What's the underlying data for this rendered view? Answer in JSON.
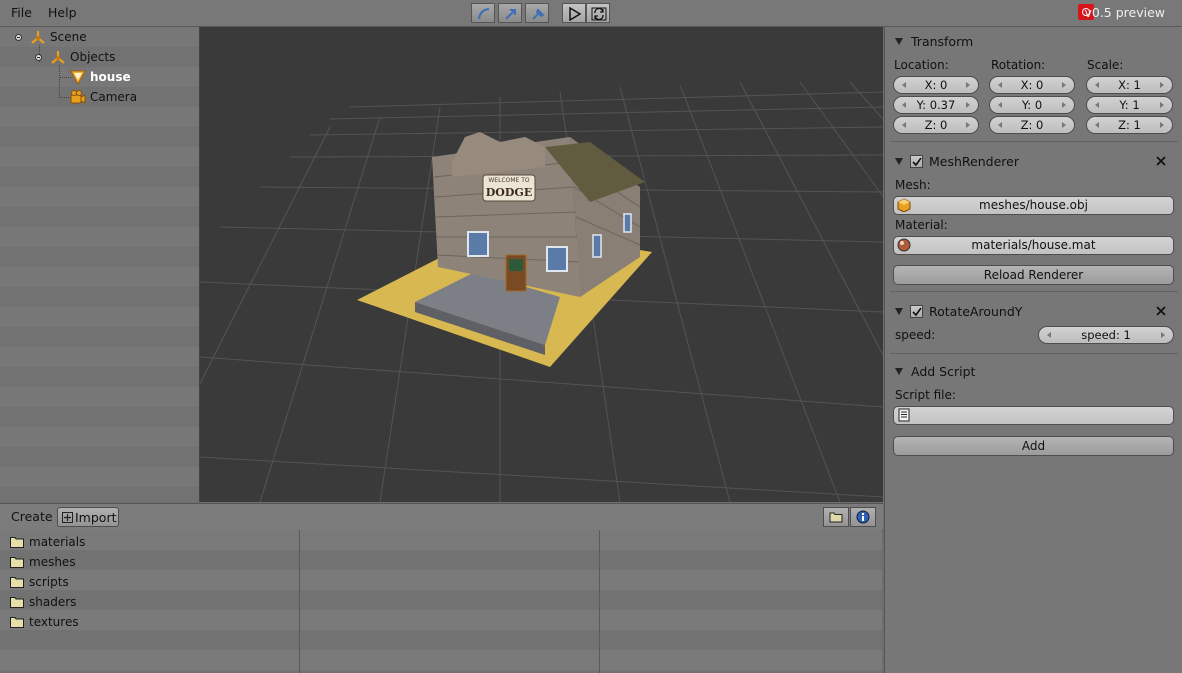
{
  "menu": {
    "file": "File",
    "help": "Help"
  },
  "toolbar": {
    "tools": [
      "curve-tool-icon",
      "move-tool-icon",
      "select-tool-icon"
    ],
    "play_icon": "play-icon",
    "refresh_icon": "refresh-icon"
  },
  "version": "v0.5 preview",
  "scene_tree": {
    "scene": "Scene",
    "objects": "Objects",
    "house": "house",
    "camera": "Camera"
  },
  "inspector": {
    "transform": {
      "title": "Transform",
      "location_label": "Location:",
      "rotation_label": "Rotation:",
      "scale_label": "Scale:",
      "location": [
        "X: 0",
        "Y: 0.37",
        "Z: 0"
      ],
      "rotation": [
        "X: 0",
        "Y: 0",
        "Z: 0"
      ],
      "scale": [
        "X: 1",
        "Y: 1",
        "Z: 1"
      ]
    },
    "mesh_renderer": {
      "title": "MeshRenderer",
      "enabled": true,
      "mesh_label": "Mesh:",
      "mesh_value": "meshes/house.obj",
      "material_label": "Material:",
      "material_value": "materials/house.mat",
      "reload_button": "Reload Renderer"
    },
    "rotate_around_y": {
      "title": "RotateAroundY",
      "enabled": true,
      "speed_label": "speed:",
      "speed_value": "speed: 1"
    },
    "add_script": {
      "title": "Add Script",
      "script_file_label": "Script file:",
      "script_file_value": "",
      "add_button": "Add"
    }
  },
  "assets": {
    "create_label": "Create",
    "import_label": "Import",
    "folders": [
      "materials",
      "meshes",
      "scripts",
      "shaders",
      "textures"
    ],
    "view_icons": [
      "folder-view-icon",
      "info-icon"
    ]
  },
  "viewport": {
    "sign_text": "DODGE",
    "sign_subtext": "WELCOME TO"
  },
  "colors": {
    "accent_orange": "#e8a020",
    "version_red": "#d7141a",
    "viewport_bg": "#3a3a3a"
  }
}
